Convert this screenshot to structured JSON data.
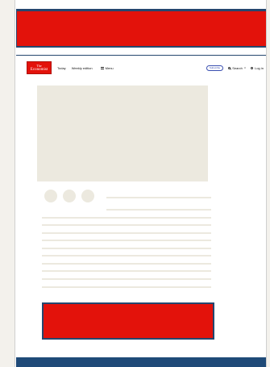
{
  "header": {
    "logo_line1": "The",
    "logo_line2": "Economist",
    "today_label": "Today",
    "weekly_label": "Weekly edition",
    "menu_label": "Menu",
    "subscribe_label": "Subscribe",
    "search_label": "Search",
    "search_chevron": "∨",
    "login_label": "Log in"
  },
  "colors": {
    "brand_red": "#e3120b",
    "navy": "#25476f",
    "placeholder": "#ece9df",
    "page_bg": "#f3f1ec",
    "subscribe_blue": "#3a4fb0"
  },
  "icons": {
    "menu": "menu-icon",
    "search": "search-icon",
    "user": "user-icon"
  }
}
